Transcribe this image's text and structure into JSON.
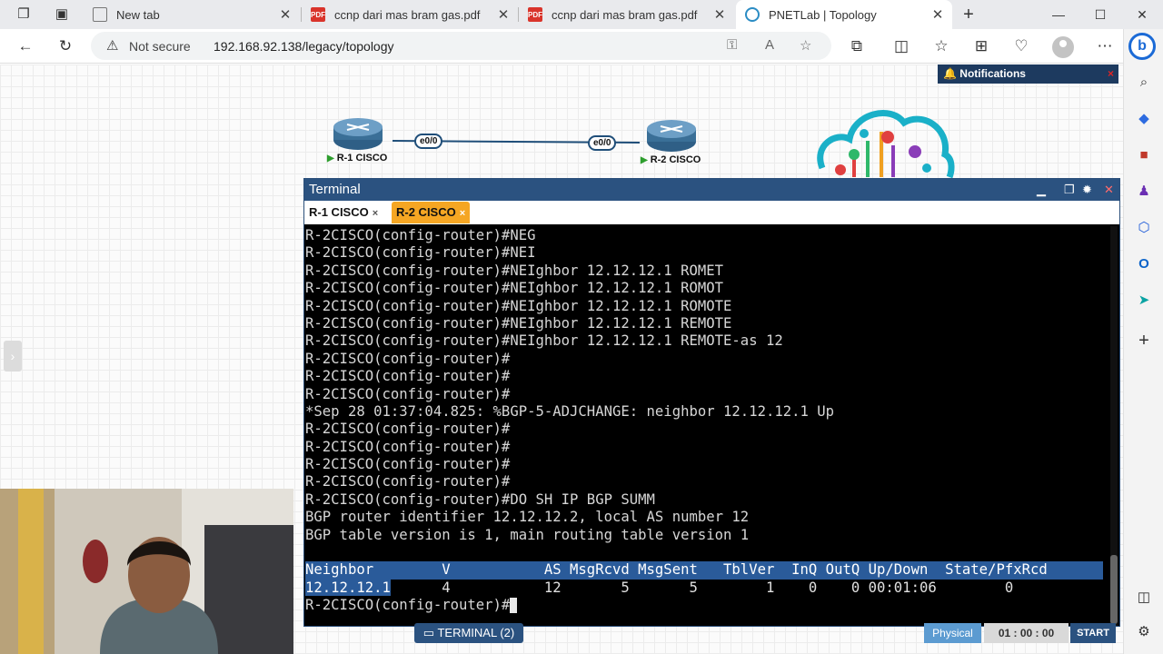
{
  "browser": {
    "tabs": [
      {
        "title": "New tab",
        "icon": "newtab-icon",
        "active": false
      },
      {
        "title": "ccnp dari mas bram gas.pdf",
        "icon": "pdf-icon",
        "active": false
      },
      {
        "title": "ccnp dari mas bram gas.pdf",
        "icon": "pdf-icon",
        "active": false
      },
      {
        "title": "PNETLab | Topology",
        "icon": "pnetlab-icon",
        "active": true
      }
    ],
    "new_tab_symbol": "+",
    "security_label": "Not secure",
    "url": "192.168.92.138/legacy/topology"
  },
  "notifications": {
    "label": "Notifications",
    "close": "×"
  },
  "topology": {
    "nodes": [
      {
        "name": "R-1 CISCO",
        "status_color": "#2e9e2e"
      },
      {
        "name": "R-2 CISCO",
        "status_color": "#2e9e2e"
      }
    ],
    "link": {
      "a_port": "e0/0",
      "b_port": "e0/0",
      "color": "#1f4e79"
    }
  },
  "terminal": {
    "title": "Terminal",
    "tabs": [
      {
        "label": "R-1 CISCO",
        "close": "×",
        "active": false
      },
      {
        "label": "R-2 CISCO",
        "close": "×",
        "active": true
      }
    ],
    "lines": [
      "R-2CISCO(config-router)#NEG",
      "R-2CISCO(config-router)#NEI",
      "R-2CISCO(config-router)#NEIghbor 12.12.12.1 ROMET",
      "R-2CISCO(config-router)#NEIghbor 12.12.12.1 ROMOT",
      "R-2CISCO(config-router)#NEIghbor 12.12.12.1 ROMOTE",
      "R-2CISCO(config-router)#NEIghbor 12.12.12.1 REMOTE",
      "R-2CISCO(config-router)#NEIghbor 12.12.12.1 REMOTE-as 12",
      "R-2CISCO(config-router)#",
      "R-2CISCO(config-router)#",
      "R-2CISCO(config-router)#",
      "*Sep 28 01:37:04.825: %BGP-5-ADJCHANGE: neighbor 12.12.12.1 Up",
      "R-2CISCO(config-router)#",
      "R-2CISCO(config-router)#",
      "R-2CISCO(config-router)#",
      "R-2CISCO(config-router)#",
      "R-2CISCO(config-router)#DO SH IP BGP SUMM",
      "BGP router identifier 12.12.12.2, local AS number 12",
      "BGP table version is 1, main routing table version 1",
      ""
    ],
    "table_header": "Neighbor        V           AS MsgRcvd MsgSent   TblVer  InQ OutQ Up/Down  State/PfxRcd",
    "table_row_addr": "12.12.12.1",
    "table_row_rest": "      4           12       5       5        1    0    0 00:01:06        0",
    "prompt": "R-2CISCO(config-router)#"
  },
  "bottom": {
    "terminal_button": "TERMINAL (2)",
    "physical": "Physical",
    "timer": "01 : 00 : 00",
    "start": "START"
  },
  "colors": {
    "terminal_title_bar": "#2b5280",
    "active_terminal_tab": "#f5a623",
    "selection": "#2a5b9a",
    "notifications_bar": "#1d3a5f"
  }
}
